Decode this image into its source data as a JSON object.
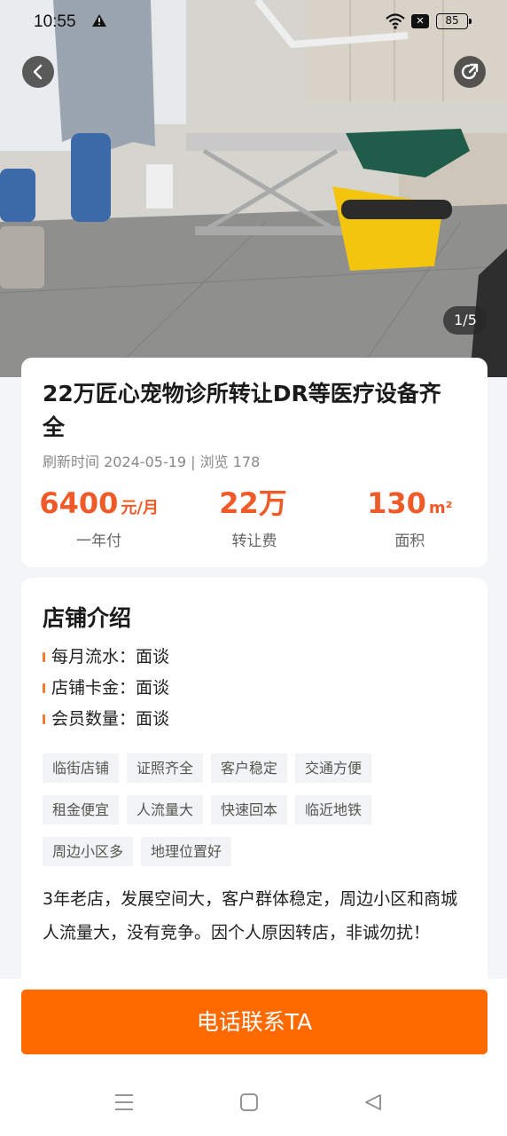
{
  "status_bar": {
    "time": "10:55",
    "battery": "85"
  },
  "gallery": {
    "counter": "1/5"
  },
  "listing": {
    "title": "22万匠心宠物诊所转让DR等医疗设备齐全",
    "meta": "刷新时间 2024-05-19 | 浏览 178",
    "stats": [
      {
        "value": "6400",
        "unit": "元/月",
        "label": "一年付"
      },
      {
        "value": "22万",
        "unit": "",
        "label": "转让费"
      },
      {
        "value": "130",
        "unit": "m²",
        "label": "面积"
      }
    ]
  },
  "intro": {
    "title": "店铺介绍",
    "rows": [
      "每月流水：面谈",
      "店铺卡金：面谈",
      "会员数量：面谈"
    ],
    "tags": [
      "临街店铺",
      "证照齐全",
      "客户稳定",
      "交通方便",
      "租金便宜",
      "人流量大",
      "快速回本",
      "临近地铁",
      "周边小区多",
      "地理位置好"
    ],
    "description": "3年老店，发展空间大，客户群体稳定，周边小区和商城人流量大，没有竞争。因个人原因转店，非诚勿扰！"
  },
  "cta": {
    "label": "电话联系TA"
  },
  "colors": {
    "accent": "#f05a28",
    "button": "#fe6a00"
  },
  "icons": [
    "back-arrow-icon",
    "share-icon",
    "warning-icon",
    "wifi-icon",
    "menu-icon",
    "home-square-icon",
    "back-triangle-icon"
  ]
}
